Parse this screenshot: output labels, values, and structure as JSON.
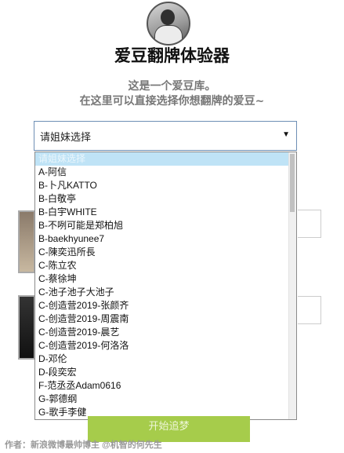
{
  "header": {
    "title": "爱豆翻牌体验器",
    "subtitle_line1": "这是一个爱豆库。",
    "subtitle_line2": "在这里可以直接选择你想翻牌的爱豆~"
  },
  "select": {
    "value": "请姐妹选择",
    "options": [
      "请姐妹选择",
      "A-阿信",
      "B-卜凡KATTO",
      "B-白敬亭",
      "B-白宇WHITE",
      "B-不咧可能是郑柏旭",
      "B-baekhyunee7",
      "C-陳奕迅所長",
      "C-陈立农",
      "C-蔡徐坤",
      "C-池子池子大池子",
      "C-创造营2019-张颜齐",
      "C-创造营2019-周震南",
      "C-创造营2019-晨艺",
      "C-创造营2019-何洛洛",
      "D-邓伦",
      "D-段奕宏",
      "F-范丞丞Adam0616",
      "G-郭德纲",
      "G-歌手李健"
    ]
  },
  "start_button": {
    "label": "开始追梦"
  },
  "footer": {
    "author": "作者：新浪微博最帅博主 @机智的何先生"
  },
  "colors": {
    "accent": "#a6cc4b",
    "selected_option": "#bfe3f6",
    "select_border": "#6e8fb5"
  }
}
